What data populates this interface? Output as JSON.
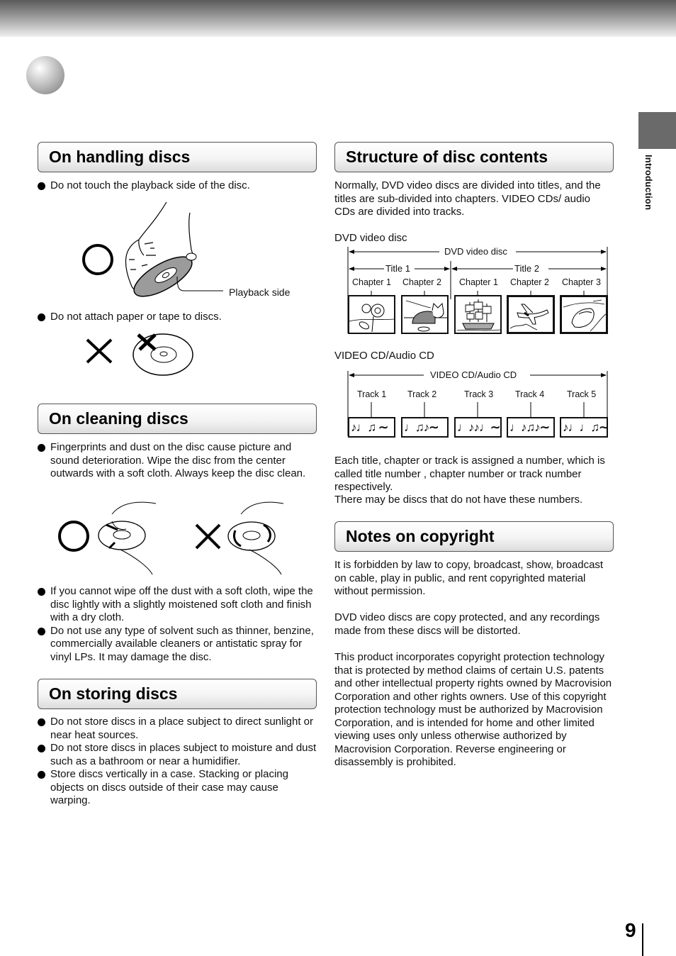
{
  "page": {
    "number": "9",
    "section_tab": "Introduction"
  },
  "left": {
    "handling": {
      "heading": "On handling discs",
      "bullets": [
        "Do not touch the playback side of the disc.",
        "Do not attach paper or tape to discs."
      ],
      "figure_label": "Playback side"
    },
    "cleaning": {
      "heading": "On cleaning discs",
      "bullets": [
        "Fingerprints and dust on the disc cause picture and sound deterioration. Wipe the disc from the center outwards with a soft cloth. Always keep the disc clean.",
        "If you cannot wipe off the dust with a soft cloth, wipe the disc lightly with a slightly moistened soft cloth and finish with a dry cloth.",
        "Do not use any type of solvent such as thinner, benzine, commercially available cleaners or antistatic spray for vinyl LPs. It may damage the disc."
      ]
    },
    "storing": {
      "heading": "On storing discs",
      "bullets": [
        "Do not store discs in a place subject to direct sunlight or near heat sources.",
        "Do not store discs in places subject to moisture and dust such as a bathroom or near a humidifier.",
        "Store discs vertically in a case. Stacking or placing objects on discs outside of their case may cause warping."
      ]
    }
  },
  "right": {
    "structure": {
      "heading": "Structure of disc contents",
      "intro": "Normally, DVD video discs are divided into titles, and the titles are sub-divided into chapters. VIDEO CDs/ audio CDs are divided into tracks.",
      "dvd": {
        "caption": "DVD video disc",
        "span_label": "DVD video disc",
        "titles": [
          {
            "label": "Title 1",
            "chapters": [
              "Chapter 1",
              "Chapter 2"
            ],
            "images": [
              "sunflower",
              "cat"
            ]
          },
          {
            "label": "Title 2",
            "chapters": [
              "Chapter 1",
              "Chapter 2",
              "Chapter 3"
            ],
            "images": [
              "sailing-ship",
              "airplane",
              "car"
            ]
          }
        ]
      },
      "vcd": {
        "caption": "VIDEO CD/Audio CD",
        "span_label": "VIDEO CD/Audio CD",
        "tracks": [
          {
            "label": "Track  1",
            "notes": "♪♩♫ ∼"
          },
          {
            "label": "Track  2",
            "notes": "♩♫♪∼"
          },
          {
            "label": "Track  3",
            "notes": "♩♪♪♩∼"
          },
          {
            "label": "Track  4",
            "notes": "♩♪♫♪∼"
          },
          {
            "label": "Track  5",
            "notes": "♪♩♩♫∼"
          }
        ]
      },
      "numbering_text": "Each title, chapter or track is assigned a number, which is called  title number ,  chapter number  or  track number  respectively.",
      "numbering_note": "There may be discs that do not have these numbers."
    },
    "copyright": {
      "heading": "Notes on copyright",
      "paragraphs": [
        "It is forbidden by law to copy, broadcast, show, broadcast on cable, play in public, and rent copyrighted material without permission.",
        "DVD video discs are copy protected, and any recordings made from these discs will be distorted.",
        "This product incorporates copyright protection technology that is protected by method claims of certain U.S. patents and other intellectual property rights owned by Macrovision Corporation and other rights owners. Use of this copyright protection technology must be authorized by Macrovision Corporation, and is intended for home and other limited viewing uses only unless otherwise authorized by Macrovision Corporation. Reverse engineering or disassembly is prohibited."
      ]
    }
  }
}
